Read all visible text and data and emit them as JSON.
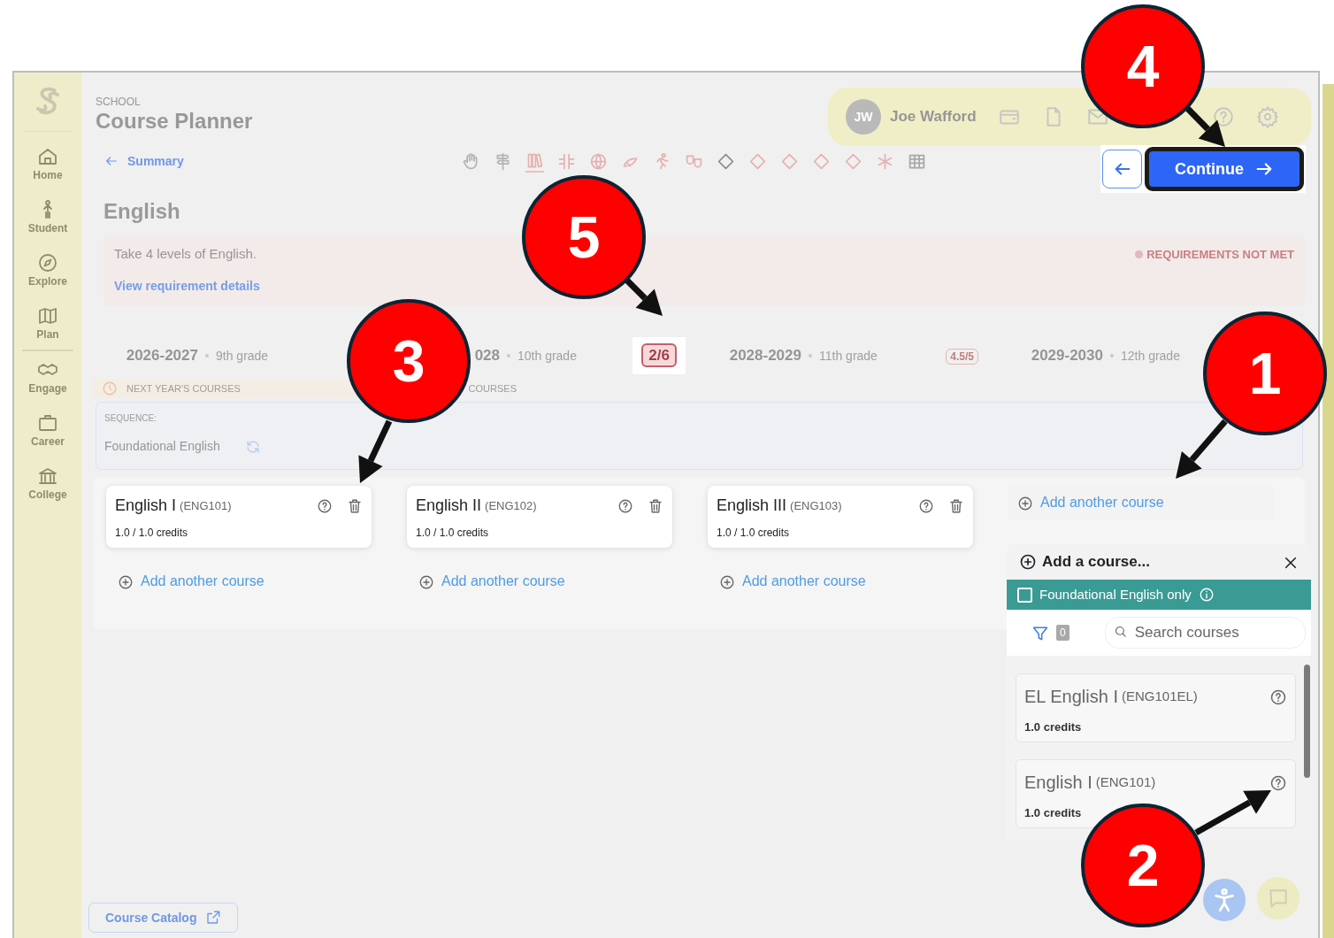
{
  "sidebar": {
    "groups": [
      [
        {
          "kind": "home",
          "label": "Home"
        },
        {
          "kind": "person",
          "label": "Student"
        },
        {
          "kind": "compass",
          "label": "Explore"
        },
        {
          "kind": "map",
          "label": "Plan"
        }
      ],
      [
        {
          "kind": "handshake",
          "label": "Engage"
        },
        {
          "kind": "briefcase",
          "label": "Career"
        },
        {
          "kind": "bank",
          "label": "College"
        }
      ]
    ]
  },
  "header": {
    "eyebrow": "SCHOOL",
    "title": "Course Planner"
  },
  "user": {
    "initials": "JW",
    "name": "Joe Wafford",
    "icons": [
      {
        "kind": "wallet"
      },
      {
        "kind": "file"
      },
      {
        "kind": "mail"
      },
      {
        "kind": "help"
      },
      {
        "kind": "gear"
      }
    ]
  },
  "back_link": "Summary",
  "subject_tabs": [
    {
      "kind": "hand",
      "color": "#b4b4b4",
      "selected": false
    },
    {
      "kind": "sign",
      "color": "#b4b4b4",
      "selected": false
    },
    {
      "kind": "books",
      "color": "#e6b0b0",
      "selected": true
    },
    {
      "kind": "hash",
      "color": "#e6b0b0",
      "selected": false
    },
    {
      "kind": "globe",
      "color": "#e6b0b0",
      "selected": false
    },
    {
      "kind": "brush",
      "color": "#e6b0b0",
      "selected": false
    },
    {
      "kind": "runner",
      "color": "#e6b0b0",
      "selected": false
    },
    {
      "kind": "masks",
      "color": "#e6b0b0",
      "selected": false
    },
    {
      "kind": "diamond",
      "color": "#8c8c8c",
      "selected": false
    },
    {
      "kind": "diamond",
      "color": "#e6b0b0",
      "selected": false
    },
    {
      "kind": "diamond",
      "color": "#e6b0b0",
      "selected": false
    },
    {
      "kind": "diamond",
      "color": "#e6b0b0",
      "selected": false
    },
    {
      "kind": "diamond",
      "color": "#e6b0b0",
      "selected": false
    },
    {
      "kind": "asterisk",
      "color": "#e6b0b0",
      "selected": false
    },
    {
      "kind": "table",
      "color": "#a8a8a8",
      "selected": false
    }
  ],
  "continue_button": "Continue",
  "subject": "English",
  "requirement": {
    "text": "Take 4 levels of English.",
    "link": "View requirement details",
    "status": "REQUIREMENTS NOT MET"
  },
  "years": [
    {
      "year": "2026-2027",
      "grade": "9th grade"
    },
    {
      "year": "028",
      "grade": "10th grade",
      "badge": "2/6",
      "highlighted": true
    },
    {
      "year": "2028-2029",
      "grade": "11th grade",
      "badge": "4.5/5",
      "highlighted": false
    },
    {
      "year": "2029-2030",
      "grade": "12th grade"
    }
  ],
  "course_headers": [
    {
      "kind": "clock",
      "label": "NEXT YEAR'S COURSES"
    },
    {
      "kind": "plain",
      "label": "COURSES"
    }
  ],
  "sequence": {
    "label": "SEQUENCE:",
    "value": "Foundational English"
  },
  "columns": [
    {
      "courses": [
        {
          "name": "English I",
          "code": "(ENG101)",
          "credits": "1.0 / 1.0 credits"
        }
      ],
      "add": "Add another course"
    },
    {
      "courses": [
        {
          "name": "English II",
          "code": "(ENG102)",
          "credits": "1.0 / 1.0 credits"
        }
      ],
      "add": "Add another course"
    },
    {
      "courses": [
        {
          "name": "English III",
          "code": "(ENG103)",
          "credits": "1.0 / 1.0 credits"
        }
      ],
      "add": "Add another course"
    },
    {
      "add": "Add another course"
    }
  ],
  "add_panel": {
    "title": "Add a course...",
    "filter": {
      "label": "Foundational English only",
      "checked": false
    },
    "filter_count": "0",
    "search": {
      "placeholder": "Search courses"
    },
    "results": [
      {
        "name": "EL English I",
        "code": "(ENG101EL)",
        "credits": "1.0 credits"
      },
      {
        "name": "English I",
        "code": "(ENG101)",
        "credits": "1.0 credits"
      }
    ]
  },
  "catalog_button": "Course Catalog",
  "callouts": [
    {
      "number": "4"
    },
    {
      "number": "5"
    },
    {
      "number": "3"
    },
    {
      "number": "1"
    },
    {
      "number": "2"
    }
  ]
}
